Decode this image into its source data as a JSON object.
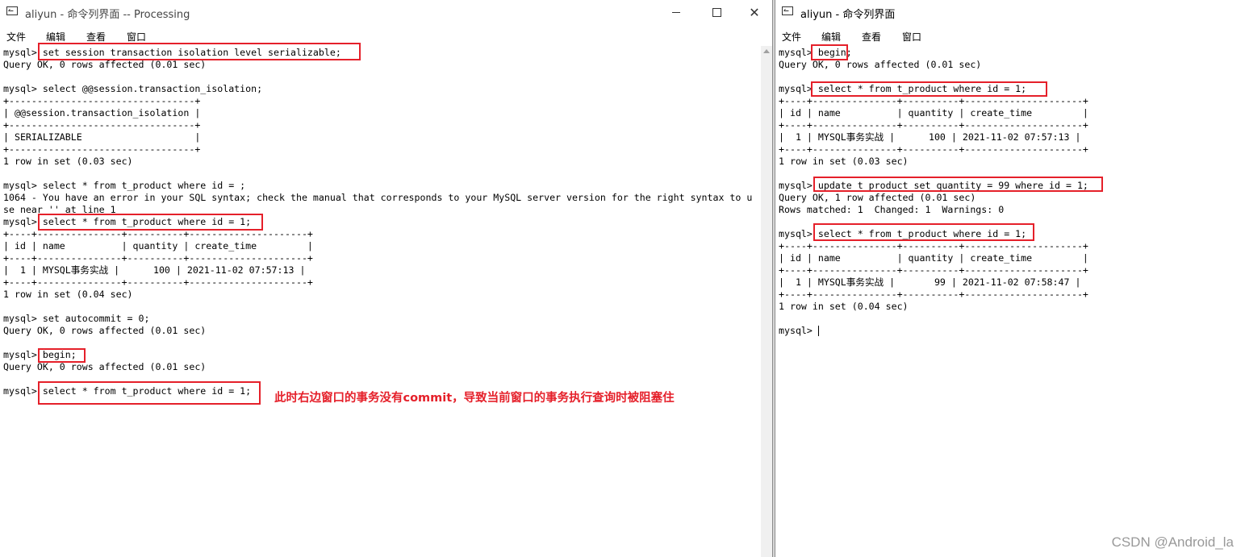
{
  "left_window": {
    "title": "aliyun - 命令列界面 -- Processing",
    "controls": {
      "minimize": "",
      "maximize": "",
      "close": "✕"
    },
    "menu": [
      "文件",
      "编辑",
      "查看",
      "窗口"
    ],
    "lines": [
      "mysql> set session transaction isolation level serializable;",
      "Query OK, 0 rows affected (0.01 sec)",
      "",
      "mysql> select @@session.transaction_isolation;",
      "+---------------------------------+",
      "| @@session.transaction_isolation |",
      "+---------------------------------+",
      "| SERIALIZABLE                    |",
      "+---------------------------------+",
      "1 row in set (0.03 sec)",
      "",
      "mysql> select * from t_product where id = ;",
      "1064 - You have an error in your SQL syntax; check the manual that corresponds to your MySQL server version for the right syntax to u",
      "se near '' at line 1",
      "mysql> select * from t_product where id = 1;",
      "+----+---------------+----------+---------------------+",
      "| id | name          | quantity | create_time         |",
      "+----+---------------+----------+---------------------+",
      "|  1 | MYSQL事务实战 |      100 | 2021-11-02 07:57:13 |",
      "+----+---------------+----------+---------------------+",
      "1 row in set (0.04 sec)",
      "",
      "mysql> set autocommit = 0;",
      "Query OK, 0 rows affected (0.01 sec)",
      "",
      "mysql> begin;",
      "Query OK, 0 rows affected (0.01 sec)",
      "",
      "mysql> select * from t_product where id = 1;"
    ],
    "annotation": "此时右边窗口的事务没有commit，导致当前窗口的事务执行查询时被阻塞住"
  },
  "right_window": {
    "title": "aliyun - 命令列界面",
    "menu": [
      "文件",
      "编辑",
      "查看",
      "窗口"
    ],
    "lines": [
      "mysql> begin;",
      "Query OK, 0 rows affected (0.01 sec)",
      "",
      "mysql> select * from t_product where id = 1;",
      "+----+---------------+----------+---------------------+",
      "| id | name          | quantity | create_time         |",
      "+----+---------------+----------+---------------------+",
      "|  1 | MYSQL事务实战 |      100 | 2021-11-02 07:57:13 |",
      "+----+---------------+----------+---------------------+",
      "1 row in set (0.03 sec)",
      "",
      "mysql> update t_product set quantity = 99 where id = 1;",
      "Query OK, 1 row affected (0.01 sec)",
      "Rows matched: 1  Changed: 1  Warnings: 0",
      "",
      "mysql> select * from t_product where id = 1;",
      "+----+---------------+----------+---------------------+",
      "| id | name          | quantity | create_time         |",
      "+----+---------------+----------+---------------------+",
      "|  1 | MYSQL事务实战 |       99 | 2021-11-02 07:58:47 |",
      "+----+---------------+----------+---------------------+",
      "1 row in set (0.04 sec)",
      "",
      "mysql> "
    ]
  },
  "watermark": "CSDN @Android_la",
  "colors": {
    "highlight": "#e5202a",
    "annotation": "#e5202a",
    "background": "#ffffff"
  }
}
